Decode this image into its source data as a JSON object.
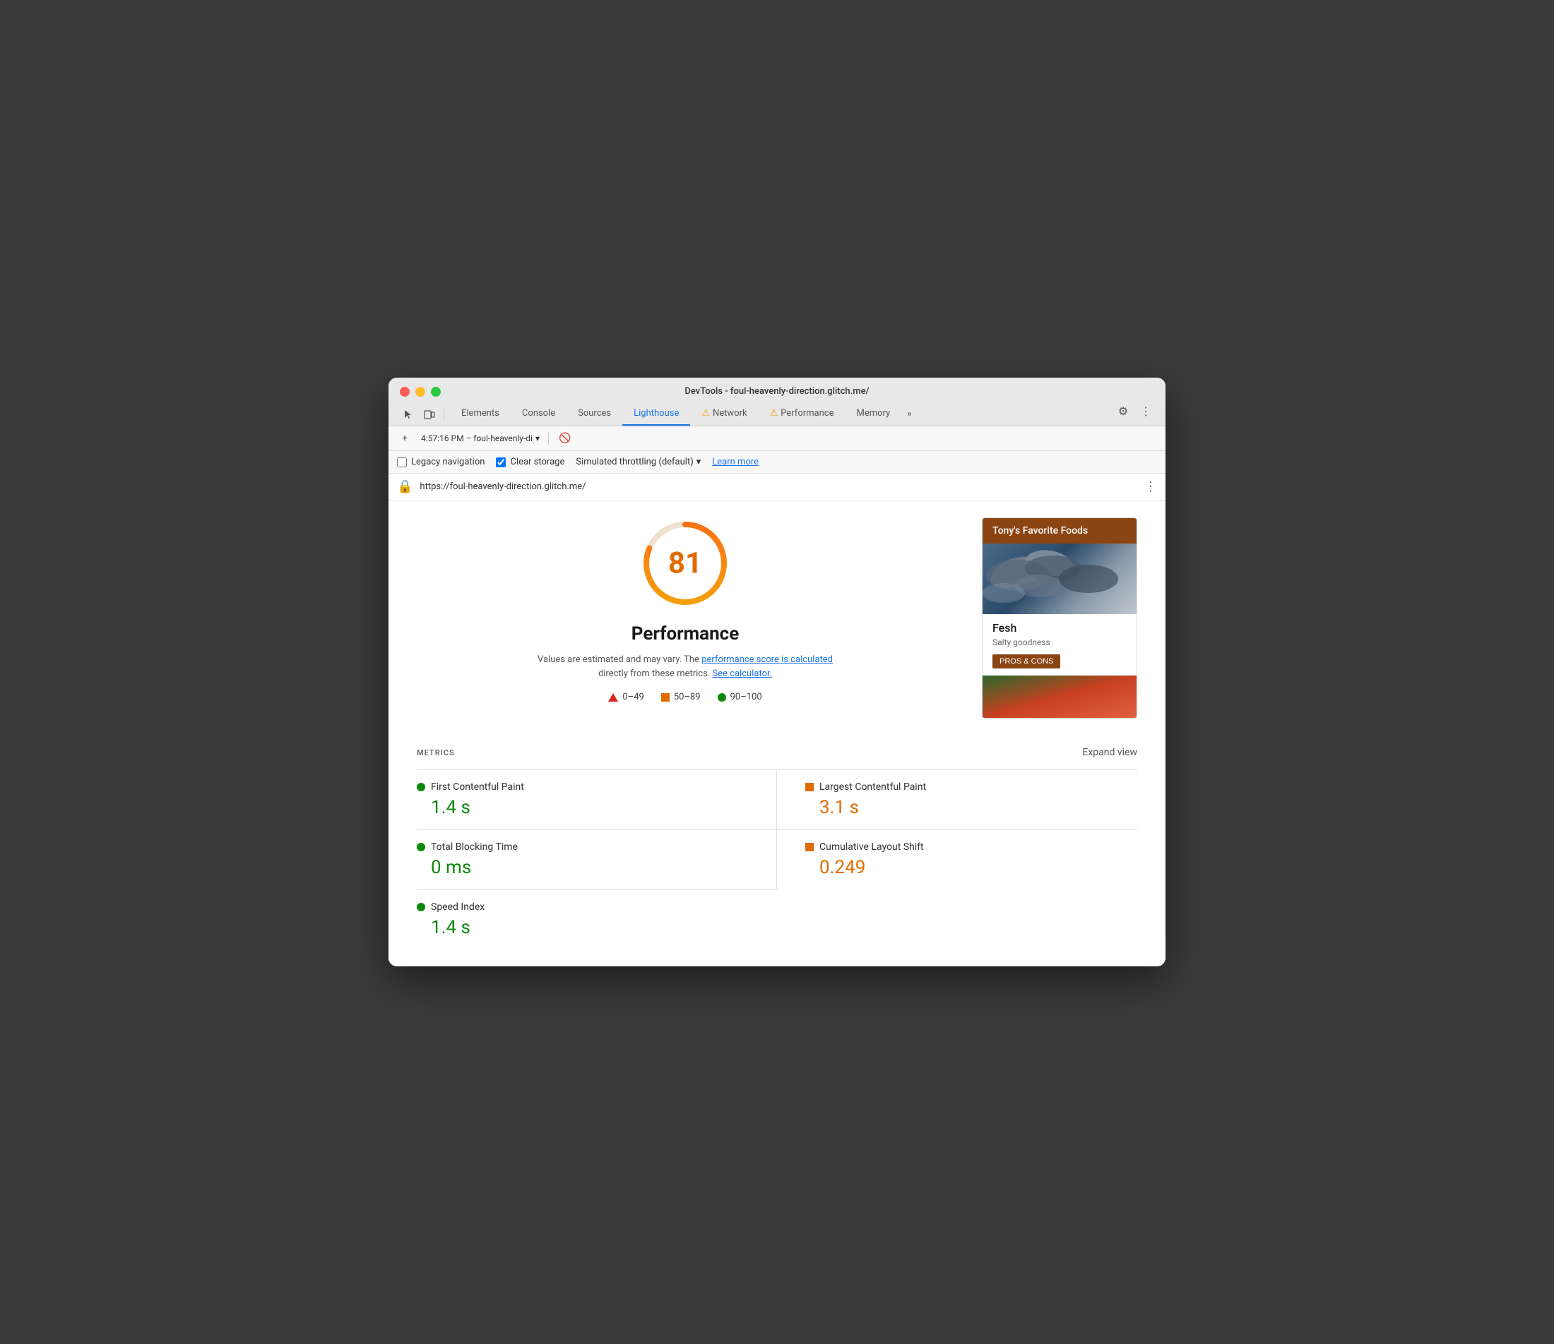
{
  "window": {
    "title": "DevTools - foul-heavenly-direction.glitch.me/"
  },
  "tabs": {
    "items": [
      {
        "label": "Elements",
        "active": false,
        "warning": false
      },
      {
        "label": "Console",
        "active": false,
        "warning": false
      },
      {
        "label": "Sources",
        "active": false,
        "warning": false
      },
      {
        "label": "Lighthouse",
        "active": true,
        "warning": false
      },
      {
        "label": "Network",
        "active": false,
        "warning": true
      },
      {
        "label": "Performance",
        "active": false,
        "warning": true
      },
      {
        "label": "Memory",
        "active": false,
        "warning": false
      }
    ],
    "more_label": "»"
  },
  "toolbar": {
    "session_label": "4:57:16 PM – foul-heavenly-di",
    "reload_icon": "⟳"
  },
  "options": {
    "legacy_navigation_label": "Legacy navigation",
    "clear_storage_label": "Clear storage",
    "simulated_throttling_label": "Simulated throttling (default)",
    "learn_more_label": "Learn more"
  },
  "url_bar": {
    "url": "https://foul-heavenly-direction.glitch.me/",
    "icon": "🔒"
  },
  "score_section": {
    "score": "81",
    "title": "Performance",
    "description_plain": "Values are estimated and may vary. The",
    "perf_score_link": "performance score is calculated",
    "description_mid": "directly from these metrics.",
    "calculator_link": "See calculator.",
    "legend": [
      {
        "range": "0–49",
        "type": "triangle",
        "color": "#e02020"
      },
      {
        "range": "50–89",
        "type": "square",
        "color": "#e06c00"
      },
      {
        "range": "90–100",
        "type": "circle",
        "color": "#0a8a0a"
      }
    ]
  },
  "preview_card": {
    "header": "Tony's Favorite Foods",
    "food_name": "Fesh",
    "food_desc": "Salty goodness",
    "button_label": "PROS & CONS"
  },
  "metrics": {
    "title": "METRICS",
    "expand_label": "Expand view",
    "items": [
      {
        "label": "First Contentful Paint",
        "value": "1.4 s",
        "status": "green",
        "indicator": "circle"
      },
      {
        "label": "Largest Contentful Paint",
        "value": "3.1 s",
        "status": "orange",
        "indicator": "square"
      },
      {
        "label": "Total Blocking Time",
        "value": "0 ms",
        "status": "green",
        "indicator": "circle"
      },
      {
        "label": "Cumulative Layout Shift",
        "value": "0.249",
        "status": "orange",
        "indicator": "square"
      },
      {
        "label": "Speed Index",
        "value": "1.4 s",
        "status": "green",
        "indicator": "circle"
      }
    ]
  }
}
